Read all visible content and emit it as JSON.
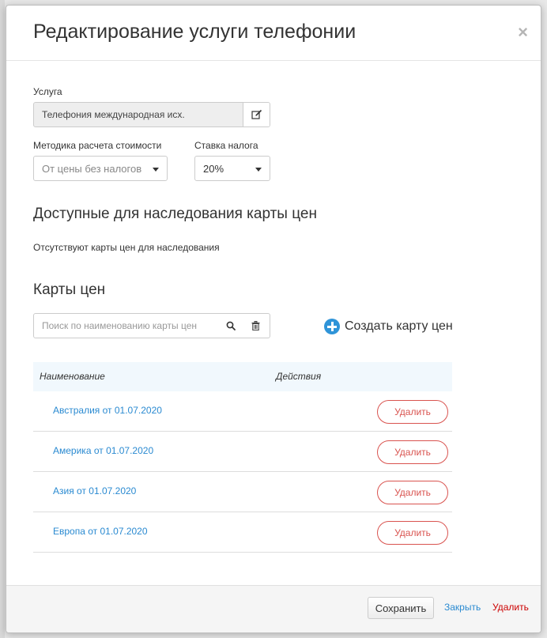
{
  "modal": {
    "title": "Редактирование услуги телефонии",
    "close_glyph": "×"
  },
  "service": {
    "label": "Услуга",
    "value": "Телефония международная исх.",
    "edit_icon": "edit-icon"
  },
  "calc_method": {
    "label": "Методика расчета стоимости",
    "value": "От цены без налогов"
  },
  "tax_rate": {
    "label": "Ставка налога",
    "value": "20%"
  },
  "inheritance": {
    "title": "Доступные для наследования карты цен",
    "empty_text": "Отсутствуют карты цен для наследования"
  },
  "price_maps": {
    "title": "Карты цен",
    "search_placeholder": "Поиск по наименованию карты цен",
    "create_label": "Создать карту цен",
    "columns": {
      "name": "Наименование",
      "actions": "Действия"
    },
    "rows": [
      {
        "name": "Австралия от 01.07.2020",
        "action": "Удалить"
      },
      {
        "name": "Америка от 01.07.2020",
        "action": "Удалить"
      },
      {
        "name": "Азия от 01.07.2020",
        "action": "Удалить"
      },
      {
        "name": "Европа от 01.07.2020",
        "action": "Удалить"
      }
    ]
  },
  "footer": {
    "save": "Сохранить",
    "close": "Закрыть",
    "delete": "Удалить"
  },
  "colors": {
    "link": "#2a8ad1",
    "danger": "#d9534f",
    "accent": "#2f94d8",
    "table_header_bg": "#f1f8fd"
  }
}
